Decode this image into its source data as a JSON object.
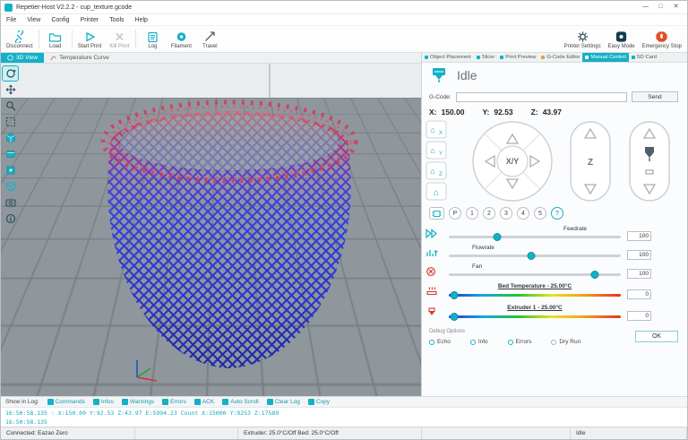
{
  "accent": "#14b1c6",
  "window": {
    "title": "Repetier-Host V2.2.2 - cup_texture.gcode",
    "controls": {
      "minimize": "—",
      "maximize": "□",
      "close": "✕"
    }
  },
  "menu": {
    "items": [
      "File",
      "View",
      "Config",
      "Printer",
      "Tools",
      "Help"
    ]
  },
  "toolbar": {
    "items": [
      {
        "label": "Disconnect"
      },
      {
        "label": "Load"
      },
      {
        "label": "Start Print"
      },
      {
        "label": "Kill Print"
      },
      {
        "label": "Log"
      },
      {
        "label": "Filament"
      },
      {
        "label": "Travel"
      }
    ],
    "right_items": [
      {
        "label": "Printer Settings"
      },
      {
        "label": "Easy Mode"
      },
      {
        "label": "Emergency Stop"
      }
    ]
  },
  "view_tabs": {
    "active": "3D View",
    "inactive": "Temperature Curve"
  },
  "right_tabs": [
    "Object Placement",
    "Slicer",
    "Print Preview",
    "G-Code Editor",
    "Manual Control",
    "SD Card"
  ],
  "manual": {
    "status": "Idle",
    "gcode_label": "G-Code:",
    "send": "Send",
    "pos": {
      "x_label": "X:",
      "x": "150.00",
      "y_label": "Y:",
      "y": "92.53",
      "z_label": "Z:",
      "z": "43.97"
    },
    "home": {
      "x": "X",
      "y": "Y",
      "z": "Z"
    },
    "dpad_center": "X/Y",
    "z_label": "Z",
    "round_buttons": [
      "P",
      "1",
      "2",
      "3",
      "4",
      "5",
      "?"
    ],
    "sliders": {
      "feedrate": {
        "label": "Feedrate",
        "value": "100"
      },
      "flowrate": {
        "label": "Flowrate",
        "value": "100"
      },
      "fan": {
        "label": "Fan",
        "value": "100"
      },
      "bed": {
        "label": "Bed Temperature - 25.00°C",
        "value": "0"
      },
      "extruder": {
        "label": "Extruder 1 - 25.00°C",
        "value": "0"
      }
    },
    "debug": {
      "label": "Debug Options",
      "options": [
        "Echo",
        "Info",
        "Errors",
        "Dry Run"
      ],
      "ok": "OK"
    }
  },
  "log_bar": {
    "label": "Show in Log:",
    "items": [
      "Commands",
      "Infos",
      "Warnings",
      "Errors",
      "ACK",
      "Auto Scroll",
      "Clear Log",
      "Copy"
    ]
  },
  "log": {
    "lines": [
      "16:50:58.135 : X:150.00 Y:92.53 Z:43.97 E:5994.23 Count X:15000 Y:9253 Z:17589",
      "16:50:58.135"
    ]
  },
  "status_bar": {
    "connection": "Connected: Eazao Zero",
    "temps": "Extruder: 25.0°C/Off  Bed: 25.0°C/Off",
    "state": "Idle"
  }
}
